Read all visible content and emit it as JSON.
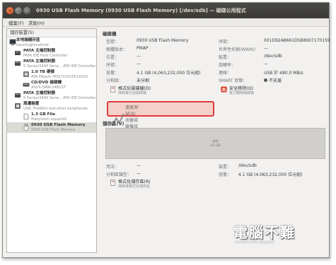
{
  "window": {
    "title": "0930 USB Flash Memory (0930 USB Flash Memory) [/dev/sdb] — 磁碟公用程式",
    "buttons": {
      "close": "×",
      "minimize": "–",
      "maximize": "□"
    }
  },
  "menubar": {
    "file": "檔案(F)",
    "help": "求助(H)"
  },
  "sidebar": {
    "header": "儲存裝置(S)",
    "devices": [
      {
        "label": "本地端儲存區",
        "detail": "ubuntu@localhost"
      },
      {
        "label": "PATA 主端控制器",
        "detail": "PATA IDE Host Controller"
      },
      {
        "label": "PATA 主端控制器",
        "detail": "5 Series/3400 Serie... ATA IDE Controller"
      },
      {
        "label": "1.0 TB 硬碟",
        "detail": "ATA Hitachi HDS721010CLA332"
      },
      {
        "label": "CD/DVD 磁碟機",
        "detail": "ASUS DRW-24B1ST"
      },
      {
        "label": "PATA 主端控制器",
        "detail": "5 Series/3400 Serie... ATA IDE Controller"
      },
      {
        "label": "周邊裝置",
        "detail": "USB, FireWire and other peripherals"
      },
      {
        "label": "1.3 GB File",
        "detail": "filesystem.squashfs"
      },
      {
        "label": "0930 USB Flash Memory",
        "detail": "0930 USB Flash Memory"
      }
    ]
  },
  "drive": {
    "section_title": "磁碟機",
    "left_rows": [
      {
        "label": "型號：",
        "value": "0930 USB Flash Memory"
      },
      {
        "label": "韌體版本：",
        "value": "PMAP"
      },
      {
        "label": "位置：",
        "value": "—"
      },
      {
        "label": "序號：",
        "value": "—"
      },
      {
        "label": "容量：",
        "value": "4.1 GB (4,063,232,000 位元組)"
      },
      {
        "label": "分割區：",
        "value": "未分割"
      }
    ],
    "right_rows": [
      {
        "label": "序號：",
        "value": "001D92A8661D5B8907170159"
      },
      {
        "label": "世界性名稱(WWN)：",
        "value": "—"
      },
      {
        "label": "裝置：",
        "value": "/dev/sdb"
      },
      {
        "label": "旋轉率：",
        "value": "—"
      },
      {
        "label": "連線：",
        "value": "USB 於 480.0 MB/s"
      },
      {
        "label": "SMART 狀態：",
        "value": "不支援"
      }
    ],
    "actions": {
      "format_title": "格式化磁碟機(D)",
      "format_desc": "抹除或分割磁碟機",
      "eject_title": "安全移除(O)",
      "eject_desc": "電力關閉磁碟機",
      "benchmark_title": "速度測試(B)",
      "benchmark_desc": "測量磁碟機效能"
    }
  },
  "volumes": {
    "section_title": "儲存區(V)",
    "bar_label": "未知",
    "bar_size": "4.1 GB",
    "left_rows": [
      {
        "label": "用法：",
        "value": "—"
      },
      {
        "label": "分割區類型：",
        "value": "—"
      }
    ],
    "right_rows": [
      {
        "label": "裝置：",
        "value": "/dev/sdb"
      },
      {
        "label": "容量：",
        "value": "4.1 GB (4,063,232,000 位元組)"
      }
    ],
    "format_title": "格式化儲存區(R)",
    "format_desc": "抹除或格式化儲存區"
  },
  "watermark": {
    "big": "電腦不難",
    "small": "pcnoshi.com.blogspot"
  },
  "colors": {
    "titlebar": "#3c3b37",
    "close_button": "#e2572d",
    "highlight_border": "#e03b3b"
  },
  "icons": {
    "computer": "computer-icon",
    "controller": "chip-icon",
    "harddisk": "harddisk-icon",
    "optical": "cdrom-icon",
    "peripheral": "usb-icon",
    "file": "file-icon",
    "flash": "usb-drive-icon",
    "format": "format-icon",
    "eject": "eject-icon",
    "benchmark": "benchmark-icon"
  }
}
